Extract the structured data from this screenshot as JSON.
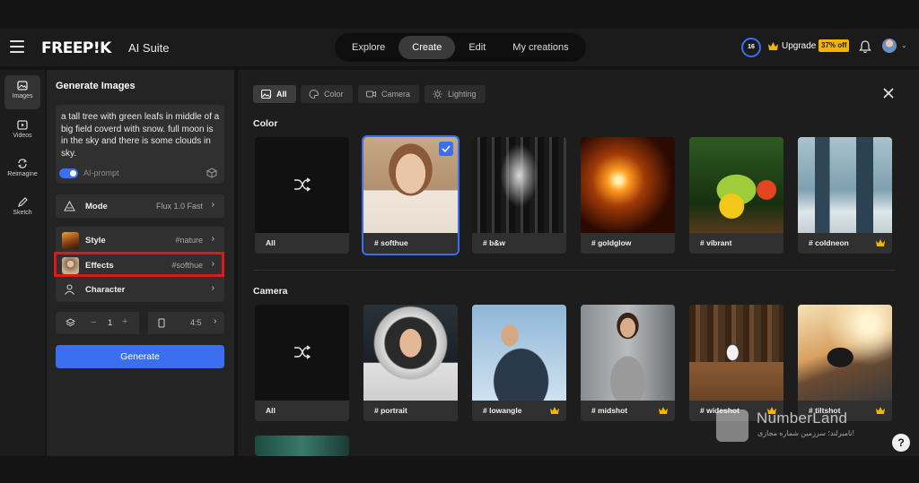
{
  "header": {
    "logo": "FREEP!K",
    "suite": "AI Suite",
    "tabs": [
      {
        "label": "Explore"
      },
      {
        "label": "Create"
      },
      {
        "label": "Edit"
      },
      {
        "label": "My creations"
      }
    ],
    "credits": "16",
    "upgrade_label": "Upgrade",
    "discount_badge": "37% off",
    "icons": [
      "menu-icon",
      "crown-icon",
      "bell-icon",
      "avatar"
    ]
  },
  "rail": {
    "items": [
      {
        "label": "Images",
        "icon": "image-icon"
      },
      {
        "label": "Videos",
        "icon": "video-icon"
      },
      {
        "label": "Reimagine",
        "icon": "reimagine-icon"
      },
      {
        "label": "Sketch",
        "icon": "pencil-icon"
      }
    ]
  },
  "generator": {
    "title": "Generate Images",
    "prompt": "a tall tree with green leafs in middle of a big field coverd with snow. full moon is in the sky and there is some clouds in sky.",
    "ai_prompt_label": "AI-prompt",
    "mode_label": "Mode",
    "mode_value": "Flux 1.0 Fast",
    "style_label": "Style",
    "style_value": "#nature",
    "effects_label": "Effects",
    "effects_value": "#softhue",
    "character_label": "Character",
    "count_value": "1",
    "minus": "−",
    "plus": "+",
    "ratio_value": "4:5",
    "generate_label": "Generate"
  },
  "panel": {
    "filters": [
      {
        "label": "All"
      },
      {
        "label": "Color"
      },
      {
        "label": "Camera"
      },
      {
        "label": "Lighting"
      }
    ],
    "sections": [
      {
        "title": "Color",
        "cards": [
          {
            "label": "All",
            "premium": false,
            "selected": false
          },
          {
            "label": "# softhue",
            "premium": false,
            "selected": true
          },
          {
            "label": "# b&w",
            "premium": false,
            "selected": false
          },
          {
            "label": "# goldglow",
            "premium": false,
            "selected": false
          },
          {
            "label": "# vibrant",
            "premium": false,
            "selected": false
          },
          {
            "label": "# coldneon",
            "premium": true,
            "selected": false
          }
        ]
      },
      {
        "title": "Camera",
        "cards": [
          {
            "label": "All",
            "premium": false,
            "selected": false
          },
          {
            "label": "# portrait",
            "premium": false,
            "selected": false
          },
          {
            "label": "# lowangle",
            "premium": true,
            "selected": false
          },
          {
            "label": "# midshot",
            "premium": true,
            "selected": false
          },
          {
            "label": "# wideshot",
            "premium": true,
            "selected": false
          },
          {
            "label": "# tiltshot",
            "premium": true,
            "selected": false
          }
        ]
      }
    ]
  },
  "watermark": {
    "title": "NumberLand",
    "subtitle": "نامبرلند؛ سرزمین شماره مجازی!"
  },
  "help_label": "?",
  "colors": {
    "accent": "#3b6ff0",
    "premium": "#f5b400",
    "highlight": "#e01818"
  }
}
